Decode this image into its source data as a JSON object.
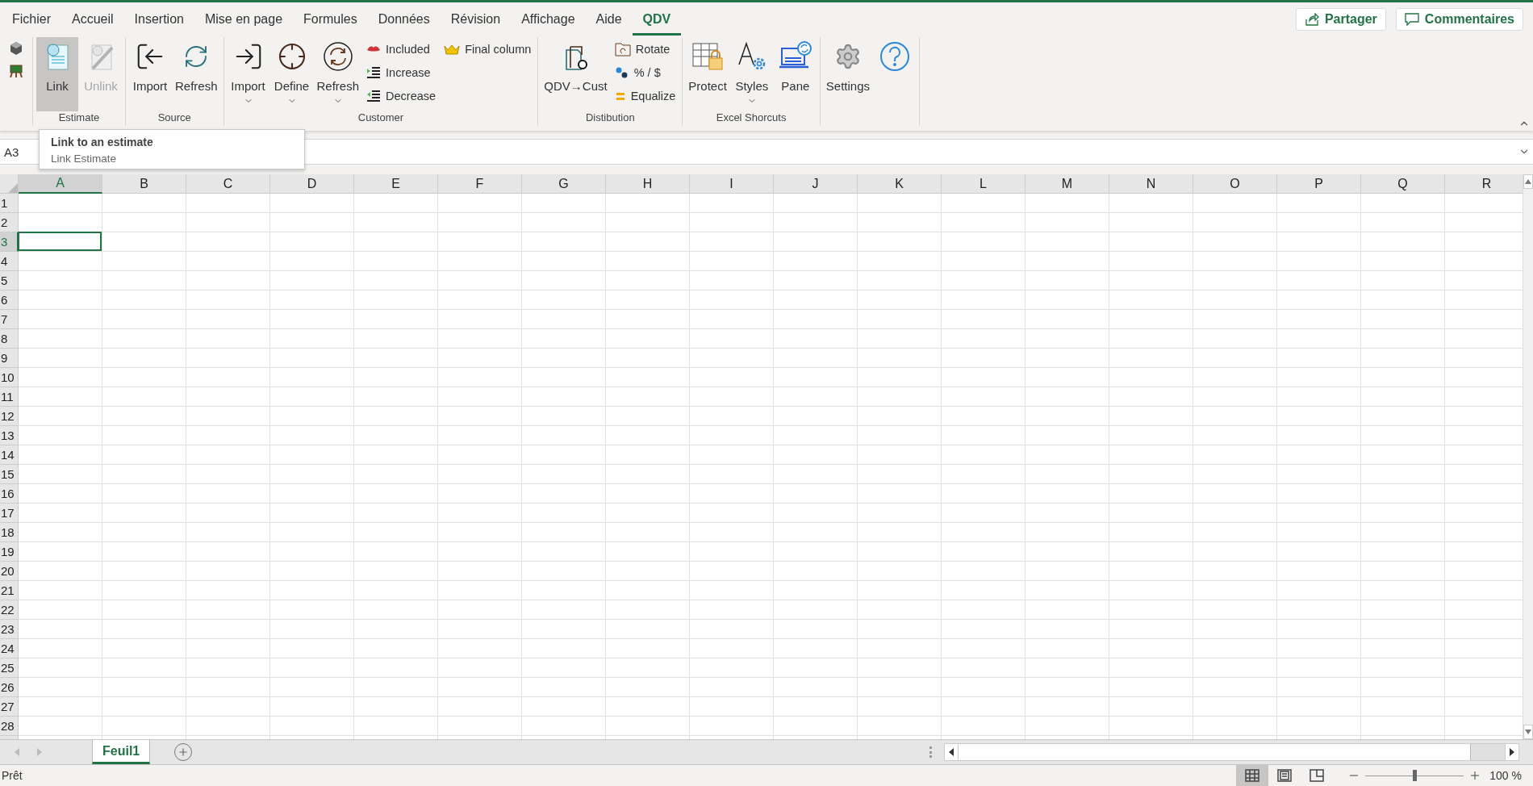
{
  "menu_tabs": [
    {
      "label": "Fichier",
      "selected": false
    },
    {
      "label": "Accueil",
      "selected": false
    },
    {
      "label": "Insertion",
      "selected": false
    },
    {
      "label": "Mise en page",
      "selected": false
    },
    {
      "label": "Formules",
      "selected": false
    },
    {
      "label": "Données",
      "selected": false
    },
    {
      "label": "Révision",
      "selected": false
    },
    {
      "label": "Affichage",
      "selected": false
    },
    {
      "label": "Aide",
      "selected": false
    },
    {
      "label": "QDV",
      "selected": true
    }
  ],
  "header_buttons": [
    {
      "kind": "share",
      "label": "Partager"
    },
    {
      "kind": "comments",
      "label": "Commentaires"
    }
  ],
  "ribbon": {
    "groups": [
      {
        "items": [
          {
            "kind": "icon"
          },
          {
            "kind": "icon"
          }
        ]
      },
      {
        "label": "Estimate",
        "items": [
          {
            "kind": "large",
            "label": "Link",
            "pressed": true,
            "disabled": false,
            "dropdown": false
          },
          {
            "kind": "large",
            "label": "Unlink",
            "pressed": false,
            "disabled": true,
            "dropdown": false
          }
        ]
      },
      {
        "label": "Source",
        "items": [
          {
            "kind": "large",
            "label": "Import",
            "pressed": false,
            "disabled": false,
            "dropdown": false
          },
          {
            "kind": "large",
            "label": "Refresh",
            "pressed": false,
            "disabled": false,
            "dropdown": false
          }
        ]
      },
      {
        "label": "Customer",
        "items": [
          {
            "kind": "large",
            "label": "Import",
            "pressed": false,
            "disabled": false,
            "dropdown": true
          },
          {
            "kind": "large",
            "label": "Define",
            "pressed": false,
            "disabled": false,
            "dropdown": true
          },
          {
            "kind": "large",
            "label": "Refresh",
            "pressed": false,
            "disabled": false,
            "dropdown": true
          },
          {
            "kind": "stack",
            "entries": [
              "Included",
              "Increase",
              "Decrease"
            ]
          },
          {
            "kind": "stack",
            "entries": [
              "Final column"
            ]
          }
        ]
      },
      {
        "label": "Distibution",
        "items": [
          {
            "kind": "large",
            "label": "QDV→Cust",
            "pressed": false,
            "disabled": false,
            "dropdown": false
          },
          {
            "kind": "stack",
            "entries": [
              "Rotate",
              "% / $",
              "Equalize"
            ]
          }
        ]
      },
      {
        "label": "Excel Shorcuts",
        "items": [
          {
            "kind": "large",
            "label": "Protect",
            "pressed": false,
            "disabled": false,
            "dropdown": false
          },
          {
            "kind": "large",
            "label": "Styles",
            "pressed": false,
            "disabled": false,
            "dropdown": true
          },
          {
            "kind": "large",
            "label": "Pane",
            "pressed": false,
            "disabled": false,
            "dropdown": false
          }
        ]
      },
      {
        "items": [
          {
            "kind": "large",
            "label": "Settings",
            "pressed": false,
            "disabled": false,
            "dropdown": false
          },
          {
            "kind": "large",
            "pressed": false,
            "disabled": false,
            "dropdown": false
          }
        ]
      }
    ]
  },
  "tooltip": {
    "title": "Link to an estimate",
    "body": "Link Estimate"
  },
  "name_box": "A3",
  "columns": [
    {
      "label": "A",
      "selected": true
    },
    {
      "label": "B",
      "selected": false
    },
    {
      "label": "C",
      "selected": false
    },
    {
      "label": "D",
      "selected": false
    },
    {
      "label": "E",
      "selected": false
    },
    {
      "label": "F",
      "selected": false
    },
    {
      "label": "G",
      "selected": false
    },
    {
      "label": "H",
      "selected": false
    },
    {
      "label": "I",
      "selected": false
    },
    {
      "label": "J",
      "selected": false
    },
    {
      "label": "K",
      "selected": false
    },
    {
      "label": "L",
      "selected": false
    },
    {
      "label": "M",
      "selected": false
    },
    {
      "label": "N",
      "selected": false
    },
    {
      "label": "O",
      "selected": false
    },
    {
      "label": "P",
      "selected": false
    },
    {
      "label": "Q",
      "selected": false
    },
    {
      "label": "R",
      "selected": false
    }
  ],
  "rows": [
    {
      "label": "1",
      "selected": false
    },
    {
      "label": "2",
      "selected": false
    },
    {
      "label": "3",
      "selected": true
    },
    {
      "label": "4",
      "selected": false
    },
    {
      "label": "5",
      "selected": false
    },
    {
      "label": "6",
      "selected": false
    },
    {
      "label": "7",
      "selected": false
    },
    {
      "label": "8",
      "selected": false
    },
    {
      "label": "9",
      "selected": false
    },
    {
      "label": "10",
      "selected": false
    },
    {
      "label": "11",
      "selected": false
    },
    {
      "label": "12",
      "selected": false
    },
    {
      "label": "13",
      "selected": false
    },
    {
      "label": "14",
      "selected": false
    },
    {
      "label": "15",
      "selected": false
    },
    {
      "label": "16",
      "selected": false
    },
    {
      "label": "17",
      "selected": false
    },
    {
      "label": "18",
      "selected": false
    },
    {
      "label": "19",
      "selected": false
    },
    {
      "label": "20",
      "selected": false
    },
    {
      "label": "21",
      "selected": false
    },
    {
      "label": "22",
      "selected": false
    },
    {
      "label": "23",
      "selected": false
    },
    {
      "label": "24",
      "selected": false
    },
    {
      "label": "25",
      "selected": false
    },
    {
      "label": "26",
      "selected": false
    },
    {
      "label": "27",
      "selected": false
    },
    {
      "label": "28",
      "selected": false
    }
  ],
  "sheet_tabs": [
    {
      "label": "Feuil1",
      "selected": true
    }
  ],
  "status_bar": {
    "text": "Prêt",
    "views": [
      {
        "kind": "normal",
        "selected": true
      },
      {
        "kind": "page_layout",
        "selected": false
      },
      {
        "kind": "page_break",
        "selected": false
      }
    ],
    "zoom": {
      "level": 0.5,
      "reading": "100 %"
    }
  }
}
